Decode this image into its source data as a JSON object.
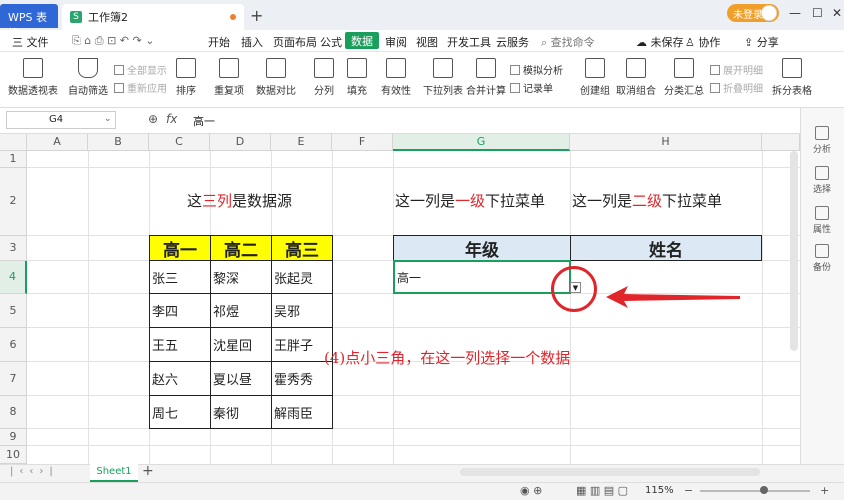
{
  "titlebar": {
    "app_tab": "WPS 表格",
    "doc_tab": "工作簿2",
    "doc_icon": "S",
    "new_tab": "+",
    "login": "未登录"
  },
  "menubar": {
    "file": "三 文件",
    "items": [
      "开始",
      "插入",
      "页面布局",
      "公式",
      "数据",
      "审阅",
      "视图",
      "开发工具",
      "云服务"
    ],
    "active": "数据",
    "search": "查找命令",
    "unsaved": "未保存",
    "collab": "协作",
    "share": "分享"
  },
  "ribbon": {
    "pivot": "数据透视表",
    "autofilter": "自动筛选",
    "show_all": "全部显示",
    "reapply": "重新应用",
    "sort": "排序",
    "duplicates": "重复项",
    "compare": "数据对比",
    "split": "分列",
    "fill": "填充",
    "validity": "有效性",
    "dropdown": "下拉列表",
    "merge_calc": "合并计算",
    "simulate": "模拟分析",
    "record": "记录单",
    "create_group": "创建组",
    "ungroup": "取消组合",
    "subtotal": "分类汇总",
    "expand": "展开明细",
    "collapse": "折叠明细",
    "split_table": "拆分表格"
  },
  "formula_bar": {
    "cell_ref": "G4",
    "fx": "fx",
    "value": "高一"
  },
  "grid": {
    "columns": [
      "A",
      "B",
      "C",
      "D",
      "E",
      "F",
      "G",
      "H"
    ],
    "rows": [
      "1",
      "2",
      "3",
      "4",
      "5",
      "6",
      "7",
      "8",
      "9",
      "10"
    ],
    "source_note_pre": "这",
    "source_note_red": "三列",
    "source_note_post": "是数据源",
    "level1_pre": "这一列是",
    "level1_red": "一级",
    "level1_post": "下拉菜单",
    "level2_pre": "这一列是",
    "level2_red": "二级",
    "level2_post": "下拉菜单",
    "table_headers": [
      "高一",
      "高二",
      "高三"
    ],
    "table_rows": [
      [
        "张三",
        "黎深",
        "张起灵"
      ],
      [
        "李四",
        "祁煜",
        "吴邪"
      ],
      [
        "王五",
        "沈星回",
        "王胖子"
      ],
      [
        "赵六",
        "夏以昼",
        "霍秀秀"
      ],
      [
        "周七",
        "秦彻",
        "解雨臣"
      ]
    ],
    "grade_header": "年级",
    "name_header": "姓名",
    "g4_value": "高一",
    "instruction": "(4)点小三角，在这一列选择一个数据"
  },
  "sheetbar": {
    "sheet": "Sheet1",
    "add": "+"
  },
  "statusbar": {
    "zoom": "115%"
  },
  "sidepanel": {
    "items": [
      "分析",
      "选择",
      "属性",
      "备份"
    ]
  },
  "colors": {
    "accent": "#1a9e5c",
    "header_yellow": "#ffff00",
    "header_blue": "#dce9f5",
    "annotation_red": "#e0252b"
  }
}
